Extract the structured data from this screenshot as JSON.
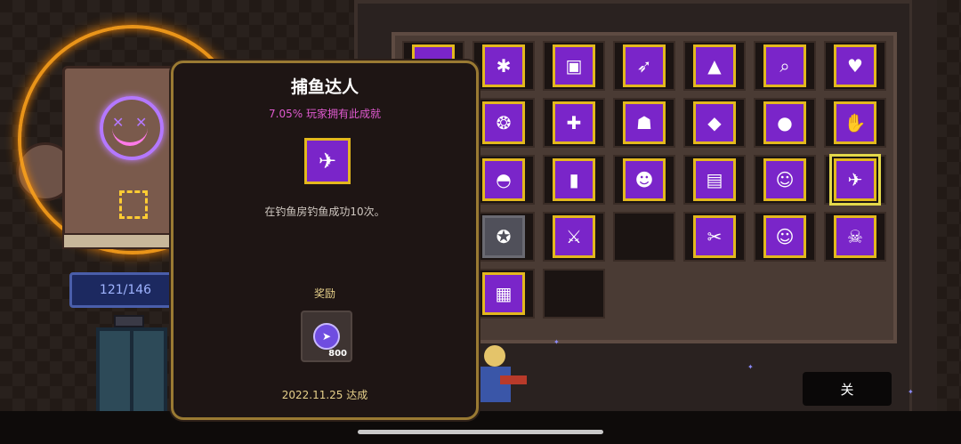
{
  "hud": {
    "progress_text": "121/146"
  },
  "popup": {
    "title": "捕鱼达人",
    "percent_text": "7.05% 玩家拥有此成就",
    "icon": "shark-icon",
    "description": "在钓鱼房钓鱼成功10次。",
    "reward_label": "奖励",
    "reward_icon": "gem-fish-icon",
    "reward_amount": "800",
    "date_text": "2022.11.25 达成"
  },
  "close_button": {
    "label": "关"
  },
  "achievements": [
    {
      "icon": "scroll-icon",
      "glyph": "✉",
      "state": "unlocked"
    },
    {
      "icon": "spider-icon",
      "glyph": "✱",
      "state": "unlocked"
    },
    {
      "icon": "chest-icon",
      "glyph": "▣",
      "state": "unlocked"
    },
    {
      "icon": "winged-boot-icon",
      "glyph": "➶",
      "state": "unlocked"
    },
    {
      "icon": "spikes-icon",
      "glyph": "▲",
      "state": "unlocked"
    },
    {
      "icon": "magnifier-icon",
      "glyph": "⌕",
      "state": "unlocked"
    },
    {
      "icon": "potion-heart-icon",
      "glyph": "♥",
      "state": "unlocked"
    },
    {
      "icon": "shield-slash-icon",
      "glyph": "⊘",
      "state": "unlocked"
    },
    {
      "icon": "fish-icon",
      "glyph": "❂",
      "state": "unlocked"
    },
    {
      "icon": "gamepad-icon",
      "glyph": "✚",
      "state": "unlocked"
    },
    {
      "icon": "tombstone-icon",
      "glyph": "☗",
      "state": "unlocked"
    },
    {
      "icon": "crystal-icon",
      "glyph": "◆",
      "state": "unlocked"
    },
    {
      "icon": "bomb-icon",
      "glyph": "●",
      "state": "unlocked"
    },
    {
      "icon": "fire-hand-icon",
      "glyph": "✋",
      "state": "unlocked"
    },
    {
      "icon": "campfire-icon",
      "glyph": "♨",
      "state": "unlocked"
    },
    {
      "icon": "helmet-icon",
      "glyph": "◓",
      "state": "unlocked"
    },
    {
      "icon": "door-icon",
      "glyph": "▮",
      "state": "unlocked"
    },
    {
      "icon": "hooded-figure-icon",
      "glyph": "☻",
      "state": "unlocked"
    },
    {
      "icon": "slot-machine-icon",
      "glyph": "▤",
      "state": "unlocked"
    },
    {
      "icon": "ghost-icon",
      "glyph": "☺",
      "state": "unlocked"
    },
    {
      "icon": "shark-icon",
      "glyph": "✈",
      "state": "selected"
    },
    {
      "icon": "broken-heart-icon",
      "glyph": "♥",
      "state": "unlocked"
    },
    {
      "icon": "medal-icon",
      "glyph": "✪",
      "state": "locked"
    },
    {
      "icon": "sword-strike-icon",
      "glyph": "⚔",
      "state": "unlocked"
    },
    {
      "icon": "empty-slot",
      "glyph": "",
      "state": "empty"
    },
    {
      "icon": "crossed-blades-icon",
      "glyph": "✂",
      "state": "unlocked"
    },
    {
      "icon": "mask-icon",
      "glyph": "☺",
      "state": "unlocked"
    },
    {
      "icon": "skull-icon",
      "glyph": "☠",
      "state": "unlocked"
    },
    {
      "icon": "roulette-icon",
      "glyph": "✺",
      "state": "unlocked"
    },
    {
      "icon": "arcade-machine-icon",
      "glyph": "▦",
      "state": "unlocked"
    },
    {
      "icon": "empty-slot",
      "glyph": "",
      "state": "empty"
    }
  ]
}
